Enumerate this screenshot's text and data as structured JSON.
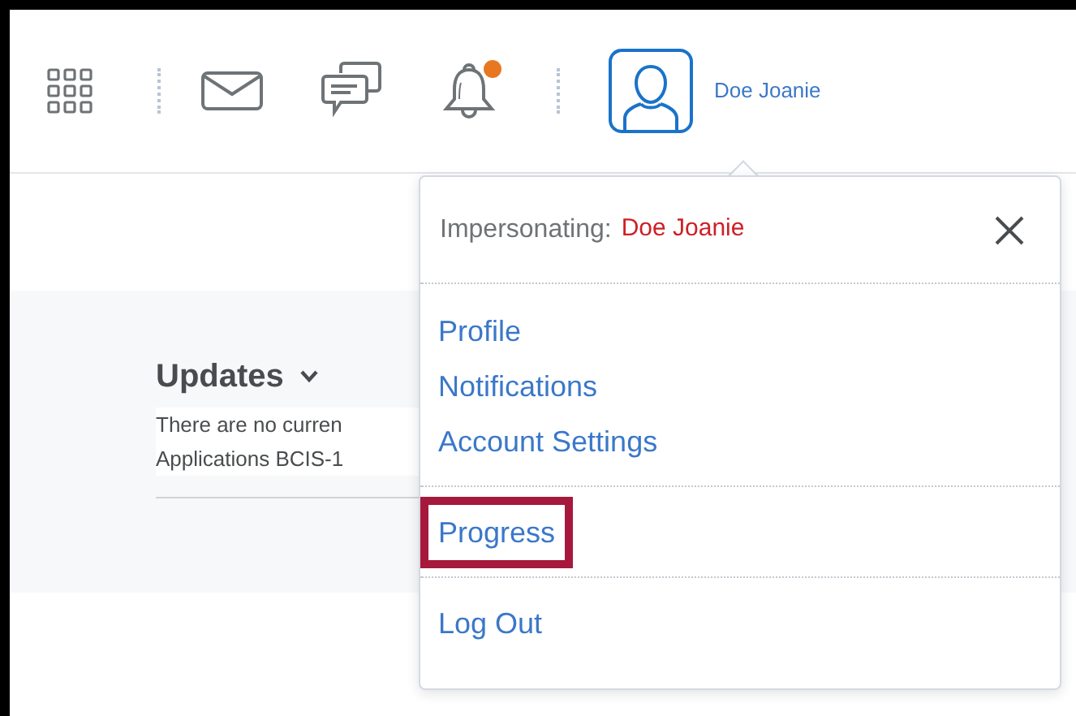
{
  "navbar": {
    "notification_dot": true,
    "user_name": "Doe Joanie"
  },
  "updates": {
    "title": "Updates",
    "lines": [
      "There are no curren",
      "Applications BCIS-1"
    ]
  },
  "user_menu": {
    "label": "Impersonating:",
    "impersonated_user": "Doe Joanie",
    "sections": [
      [
        {
          "label": "Profile",
          "highlighted": false
        },
        {
          "label": "Notifications",
          "highlighted": false
        },
        {
          "label": "Account Settings",
          "highlighted": false
        }
      ],
      [
        {
          "label": "Progress",
          "highlighted": true
        }
      ],
      [
        {
          "label": "Log Out",
          "highlighted": false
        }
      ]
    ]
  }
}
